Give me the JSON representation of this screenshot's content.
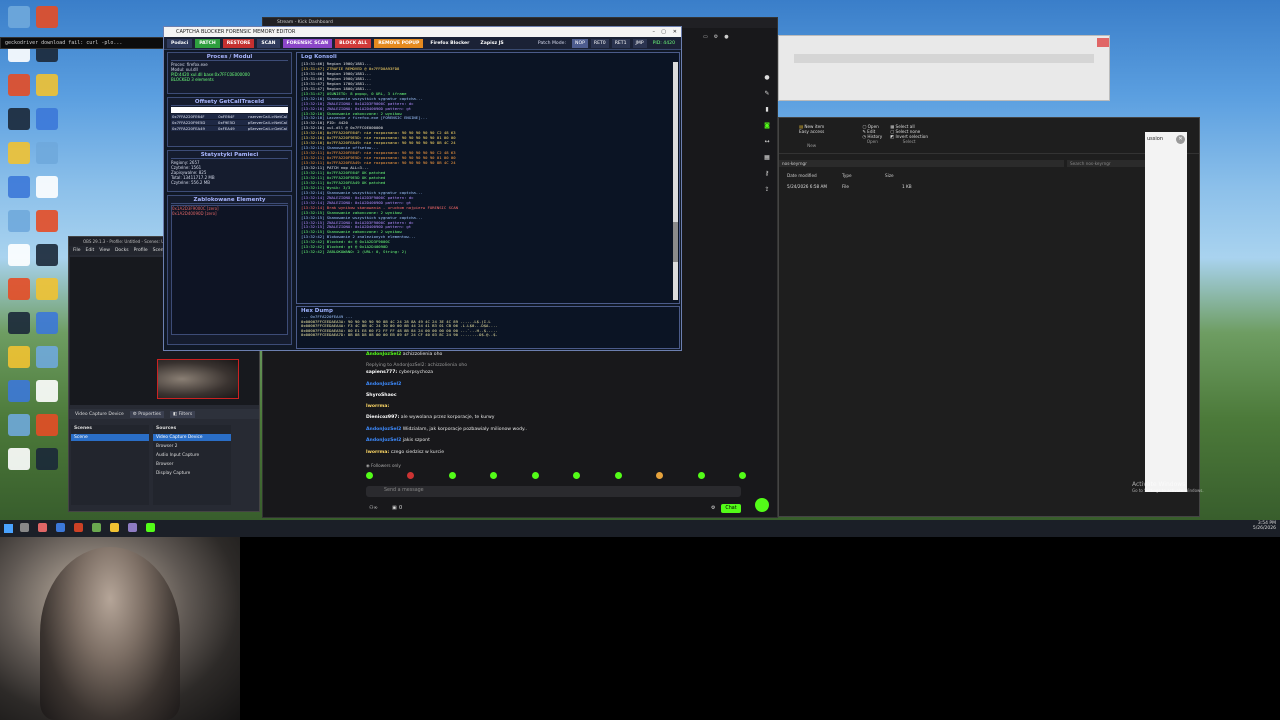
{
  "desktop": {
    "icons": [
      {
        "label": "This PC",
        "color": "#6fa8dc"
      },
      {
        "label": "OBS",
        "color": "#ffffff"
      },
      {
        "label": "Brave",
        "color": "#e44d26"
      },
      {
        "label": "Steam",
        "color": "#1b2838"
      },
      {
        "label": "Files",
        "color": "#f1c232"
      },
      {
        "label": "Apps",
        "color": "#3c78d8"
      }
    ],
    "watermark_line1": "Activate Windows",
    "watermark_line2": "Go to Settings to activate Windows."
  },
  "cmd_window": {
    "text": "geckodriver download fail: curl -plo..."
  },
  "tool": {
    "title": "CAPTCHA BLOCKER FORENSIC MEMORY EDITOR",
    "toolbar": {
      "scan_label": "Podaci",
      "patch_label": "PATCH",
      "restore_label": "RESTORE",
      "scan2_label": "SCAN",
      "forensic_label": "FORENSIC SCAN",
      "block_label": "BLOCK ALL",
      "remove_label": "REMOVE POPUP",
      "firefox_label": "Firefox Blocker",
      "zapisz_label": "Zapisz JS",
      "patch_mode_label": "Patch Mode:",
      "mode_nop": "NOP",
      "mode_ret0": "RET0",
      "mode_ret1": "RET1",
      "mode_jmp": "JMP",
      "pid": "PID: 4420"
    },
    "proces_panel": {
      "title": "Proces / Modul",
      "lines": [
        "Proces: firefox.exe",
        "Modul: xul.dll"
      ],
      "green_lines": [
        "PID:4420 xul.dll base:0x7FFC0E000000",
        "BLOCKED 3 elements"
      ]
    },
    "offsets_panel": {
      "title": "Offsety GetCallTraceId",
      "rows": [
        [
          "0x7FFA220FE64F",
          "0xFE64F",
          "nserverCall->NetCal"
        ],
        [
          "0x7FFA220F9E5D",
          "0xF9E5D",
          "pServerCall->NetCal"
        ],
        [
          "0x7FFA220FEA49",
          "0xFEA49",
          "pServerCall->GetCal"
        ]
      ]
    },
    "stats_panel": {
      "title": "Statystyki Pamieci",
      "lines": [
        "Regiony: 2657",
        "Czytelne: 1561",
        "Zapisywalne: 825",
        "Total: 13411717.2 MB",
        "Czytelne: 556.2 MB"
      ]
    },
    "blocked_panel": {
      "title": "Zablokowane Elementy",
      "lines": [
        "0x1A2D3F9000C [zero]",
        "0x1A2D40090D [zero]"
      ]
    },
    "console_title": "Log Konsoli",
    "console_lines": [
      {
        "text": "[13:31:46]   Region 1900/1881...",
        "color": "#e8e8e8"
      },
      {
        "text": "[13:31:47]   ZTRAFIE REMOVED @ 0x7FFD0A93FD8",
        "color": "#ffd966"
      },
      {
        "text": "[13:31:46]   Region 1900/1881...",
        "color": "#e8e8e8"
      },
      {
        "text": "[13:31:46]   Region 1900/1881...",
        "color": "#e8e8e8"
      },
      {
        "text": "[13:31:47]   Region 1700/1881...",
        "color": "#e8e8e8"
      },
      {
        "text": "[13:31:47]   Region 1800/1881...",
        "color": "#e8e8e8"
      },
      {
        "text": "[13:31:47] USUNIETO: 8 popup, 0 URL, 3 iframe",
        "color": "#6cff7a"
      },
      {
        "text": "[13:32:10] Skanowanie wszystkich sygnatur captcha...",
        "color": "#9fc5ff"
      },
      {
        "text": "[13:32:10] ZNALEZIONO: 0x1A2D3F9000C pattern: dc",
        "color": "#b48cff"
      },
      {
        "text": "[13:32:10] ZNALEZIONO: 0x1A2D40090D pattern: gt",
        "color": "#b48cff"
      },
      {
        "text": "[13:32:10] Skanowanie zakonczone: 2 wynikow",
        "color": "#6cff7a"
      },
      {
        "text": "[13:32:10] Laczenie z firefox.exe [FORENSIC ENGINE]...",
        "color": "#9fc5ff"
      },
      {
        "text": "[13:32:10] PID: 4420",
        "color": "#e8e8e8"
      },
      {
        "text": "[13:32:10] xul.dll @ 0x7FFC0E000000",
        "color": "#e8e8e8"
      },
      {
        "text": "[13:32:10]   0x7FFA220FE64F: nie rozpoznano: 90 90 90 90 90 C2 48 63",
        "color": "#ffd966"
      },
      {
        "text": "[13:32:10]   0x7FFA220F9E5D: nie rozpoznano: 90 90 90 90 90 01 00 00",
        "color": "#ffd966"
      },
      {
        "text": "[13:32:10]   0x7FFA220FEA49: nie rozpoznano: 90 90 90 90 90 8B 4C 24",
        "color": "#ffd966"
      },
      {
        "text": "[13:32:11] Skanowanie offsetow...",
        "color": "#9fc5ff"
      },
      {
        "text": "[13:32:11] 0x7FFA220FE64F: nie rozpoznano: 90 90 90 90 90 C2 48 63",
        "color": "#ff9f40"
      },
      {
        "text": "[13:32:11] 0x7FFA220F9E5D: nie rozpoznano: 90 90 90 90 90 01 00 00",
        "color": "#ff9f40"
      },
      {
        "text": "[13:32:11] 0x7FFA220FEA49: nie rozpoznano: 90 90 90 90 90 8B 4C 24",
        "color": "#ff9f40"
      },
      {
        "text": "[13:32:11] PATCH nop ALL=3...",
        "color": "#e8e8e8"
      },
      {
        "text": "[13:32:11]   0x7FFA220FE64F OK patched",
        "color": "#6cff7a"
      },
      {
        "text": "[13:32:11]   0x7FFA220F9E5D OK patched",
        "color": "#6cff7a"
      },
      {
        "text": "[13:32:11]   0x7FFA220FEA49 OK patched",
        "color": "#6cff7a"
      },
      {
        "text": "[13:32:11] Wynik: 3/3",
        "color": "#6cff7a"
      },
      {
        "text": "[13:32:14] Skanowanie wszystkich sygnatur captcha...",
        "color": "#9fc5ff"
      },
      {
        "text": "[13:32:14] ZNALEZIONO: 0x1A2D3F9000C pattern: dc",
        "color": "#b48cff"
      },
      {
        "text": "[13:32:14] ZNALEZIONO: 0x1A2D40090D pattern: gt",
        "color": "#b48cff"
      },
      {
        "text": "[13:32:14] Brak wynikow skanowania - uruchom najpierw FORENSIC SCAN",
        "color": "#ff6b6b"
      },
      {
        "text": "[13:32:15] Skanowanie zakonczone: 2 wynikow",
        "color": "#6cff7a"
      },
      {
        "text": "[13:32:15] Skanowanie wszystkich sygnatur captcha...",
        "color": "#9fc5ff"
      },
      {
        "text": "[13:32:15] ZNALEZIONO: 0x1A2D3F9000C pattern: dc",
        "color": "#b48cff"
      },
      {
        "text": "[13:32:15] ZNALEZIONO: 0x1A2D40090D pattern: gt",
        "color": "#b48cff"
      },
      {
        "text": "[13:32:15] Skanowanie zakonczone: 2 wynikow",
        "color": "#6cff7a"
      },
      {
        "text": "[13:32:42] Blokowanie 2 znalezionych elementow...",
        "color": "#9fc5ff"
      },
      {
        "text": "[13:32:42]   Blocked: dc @ 0x1A2D3F9000C",
        "color": "#6cff7a"
      },
      {
        "text": "[13:32:42]   Blocked: gt @ 0x1A2D40090D",
        "color": "#6cff7a"
      },
      {
        "text": "[13:32:42] ZABLOKOWANO: 2 (URL: 0, String: 2)",
        "color": "#6cff7a"
      }
    ],
    "hex_title": "Hex Dump",
    "hex_lines": [
      "--- 0x7FFA220FEA49 ---",
      "0x00007FFCEEDAEA3A: 90 90 90 90 90 8B 4C 24 28 8A 49 4C 24 3E 4C 89  ......L$.(I.L",
      "0x00007FFCEEDAEA4A: F3 4C 8B 4C 24 30 00 00 8B 44 24 41 B3 01 CB 06  .L.L$0...D$A....",
      "0x00007FFCEEDAEA5A: 80 E1 E8 60 F2 FF FF 48 8B 84 24 00 00 00 00 00  ...`...H..$.....",
      "0x00007FFCEEDAEA7D: 8B 88 D8 08 00 00 EB 89 4F 24 CF 40 03 8C 24 90  ........O$.@..$."
    ]
  },
  "chat": {
    "window_title": "Stream - Kick Dashboard",
    "messages": [
      {
        "user": "AndonJozSel2",
        "text": "achizzolienia oho",
        "color": "#53fc18"
      },
      {
        "user": "",
        "text": "Replying to AndonJozSel2: achizzolienia oho",
        "color": "#999999"
      },
      {
        "user": "sapiens777:",
        "text": "cyberpsychoza",
        "color": "#ffffff"
      },
      {
        "user": "AndonJozSel2",
        "text": "",
        "color": "#3d8bff"
      },
      {
        "user": "ShyroShaoc",
        "text": "",
        "color": "#ffffff"
      },
      {
        "user": "lworrma:",
        "text": "",
        "color": "#ffd966"
      },
      {
        "user": "Dienicoz997:",
        "text": "ale wywolana przez korporacje, te kurwy",
        "color": "#ffffff"
      },
      {
        "user": "AndonJozSel2",
        "text": "Widzialam, jak korporacje pozbawialy milionow wody..",
        "color": "#3d8bff"
      },
      {
        "user": "AndonJozSel2",
        "text": "jakis szpont",
        "color": "#3d8bff"
      },
      {
        "user": "lworrma:",
        "text": "czego siedzisz w kurcie",
        "color": "#ffd966"
      }
    ],
    "followers_label": "Followers only",
    "input_placeholder": "Send a message",
    "count": "0",
    "chat_button": "Chat"
  },
  "explorer": {
    "toolbar_items": [
      "New item",
      "Easy access",
      "Open",
      "Edit",
      "History",
      "Select all",
      "Select none",
      "Invert selection"
    ],
    "groups": [
      "New",
      "Open",
      "Select"
    ],
    "address": "nos-keyrngr",
    "search_placeholder": "Search nos-keyrngr",
    "columns": [
      "Date modified",
      "Type",
      "Size"
    ],
    "row": {
      "date": "5/24/2026 6:58 AM",
      "type": "File",
      "size": "1 KB"
    },
    "side_text": [
      "ussion"
    ]
  },
  "obs": {
    "title": "OBS 29.1.3 - Profile: Untitled - Scenes: Untitled",
    "menu": [
      "File",
      "Edit",
      "View",
      "Docks",
      "Profile",
      "Scene"
    ],
    "source_name": "Video Capture Device",
    "properties_label": "Properties",
    "filters_label": "Filters",
    "scenes_title": "Scenes",
    "sources_title": "Sources",
    "scene_item": "Scene",
    "sources": [
      "Video Capture Device",
      "Browser 2",
      "Audio Input Capture",
      "Browser",
      "Display Capture"
    ]
  },
  "taskbar": {
    "time": "3:54 PM",
    "date": "5/26/2026"
  }
}
